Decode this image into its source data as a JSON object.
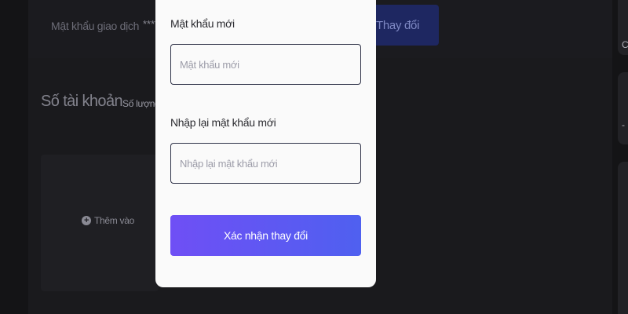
{
  "background": {
    "transaction_password": {
      "label": "Mật khẩu giao dịch",
      "masked_value": "****",
      "change_button": "Thay đổi"
    },
    "account_section": {
      "title": "Số tài khoản",
      "quantity_label": "Số lượng",
      "add_label": "Thêm vào"
    },
    "edge_chars": [
      "C",
      "-"
    ]
  },
  "modal": {
    "new_password": {
      "label": "Mật khẩu mới",
      "placeholder": "Mật khẩu mới",
      "value": ""
    },
    "confirm_password": {
      "label": "Nhập lại mật khẩu mới",
      "placeholder": "Nhập lại mật khẩu mới",
      "value": ""
    },
    "submit_label": "Xác nhận thay đổi"
  },
  "colors": {
    "page_background": "#141416",
    "modal_background": "#fafafa",
    "submit_gradient_start": "#6f4ff5",
    "submit_gradient_end": "#4f60f0",
    "change_button": "#1e2761"
  },
  "icons": {
    "add": "plus-circle-icon"
  }
}
